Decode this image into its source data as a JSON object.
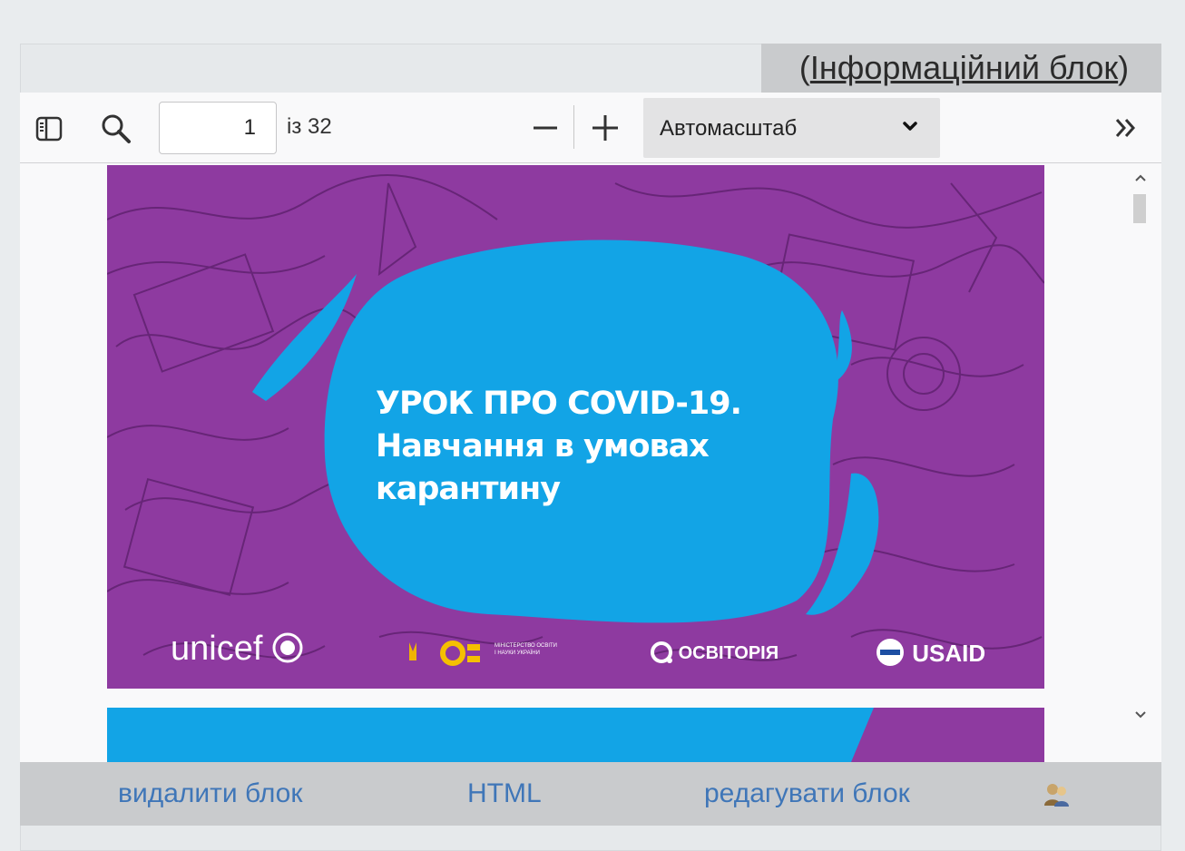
{
  "info_block": {
    "open_paren": "(",
    "link_label": "Інформаційний блок",
    "close_paren": ")"
  },
  "toolbar": {
    "sidebar_icon": "sidebar-toggle-icon",
    "search_icon": "search-icon",
    "page_number": "1",
    "page_of": "із 32",
    "zoom_out_icon": "minus-icon",
    "zoom_in_icon": "plus-icon",
    "zoom_value": "Автомасштаб",
    "more_icon": "double-chevron-right-icon"
  },
  "slide": {
    "title_lines": [
      "УРОК ПРО COVID-19.",
      "Навчання в умовах",
      "карантину"
    ],
    "logos": {
      "unicef": "unicef",
      "ministry": "МІНІСТЕРСТВО ОСВІТИ І НАУКИ УКРАЇНИ",
      "osvitoria": "ОСВІТОРІЯ",
      "usaid": "USAID"
    }
  },
  "actions": {
    "delete_label": "видалити блок",
    "html_label": "HTML",
    "edit_label": "редагувати блок",
    "user_icon": "users-icon"
  },
  "colors": {
    "slide_purple": "#8e3aa0",
    "bubble_blue": "#12a4e6",
    "link_blue": "#3f76b8"
  }
}
